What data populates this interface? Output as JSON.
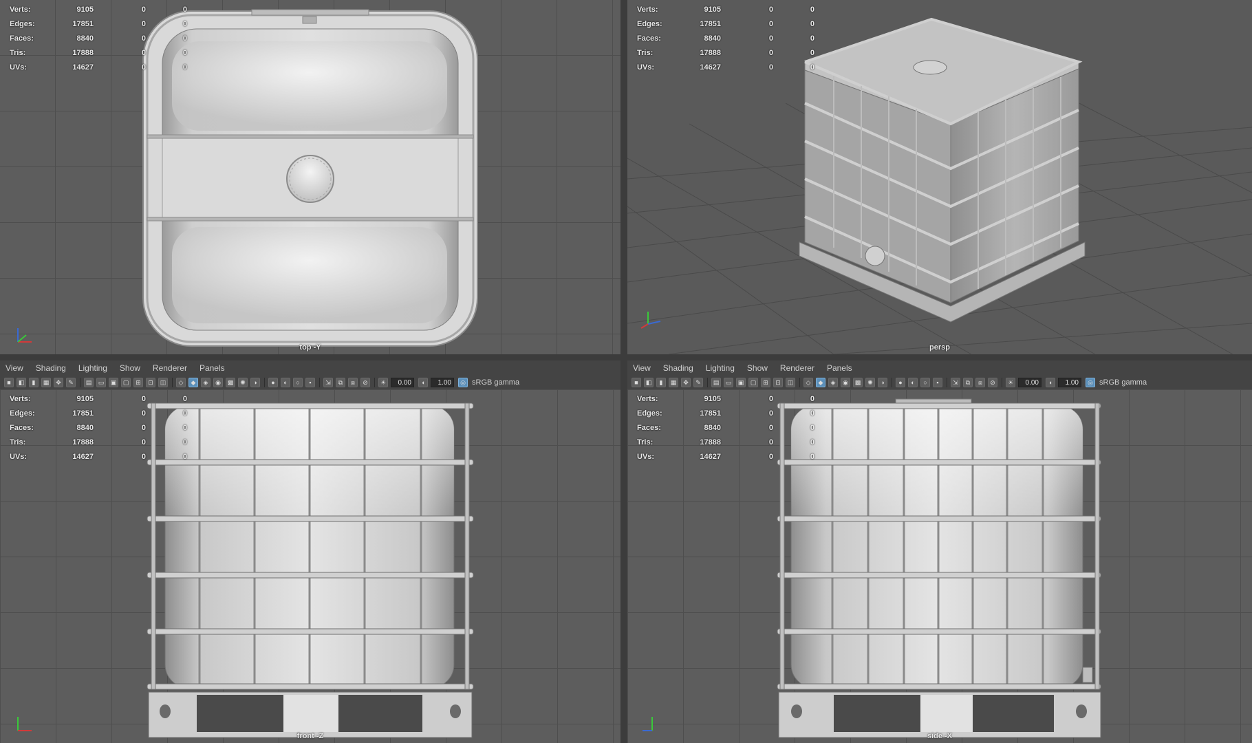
{
  "hud_stats": [
    {
      "label": "Verts:",
      "value": "9105",
      "sel": "0",
      "comp": "0"
    },
    {
      "label": "Edges:",
      "value": "17851",
      "sel": "0",
      "comp": "0"
    },
    {
      "label": "Faces:",
      "value": "8840",
      "sel": "0",
      "comp": "0"
    },
    {
      "label": "Tris:",
      "value": "17888",
      "sel": "0",
      "comp": "0"
    },
    {
      "label": "UVs:",
      "value": "14627",
      "sel": "0",
      "comp": "0"
    }
  ],
  "viewports": {
    "top": {
      "camera": "top -Y"
    },
    "persp": {
      "camera": "persp"
    },
    "front": {
      "camera": "front -Z"
    },
    "side": {
      "camera": "side -X"
    }
  },
  "panel_menu": [
    "View",
    "Shading",
    "Lighting",
    "Show",
    "Renderer",
    "Panels"
  ],
  "toolbar": {
    "exposure": "0.00",
    "gamma": "1.00",
    "color_space": "sRGB gamma"
  },
  "icons": {
    "camera": "camera-icon",
    "wireframe": "wireframe-icon",
    "smooth_shade": "smooth-shade-icon",
    "textured": "textured-icon",
    "lights": "lights-icon",
    "shadows": "shadows-icon",
    "isolate": "isolate-icon",
    "xray": "xray-icon",
    "exposure": "exposure-icon",
    "gamma": "gamma-icon",
    "color_mgmt": "color-management-icon"
  },
  "colors": {
    "viewport_bg": "#5d5d5d",
    "ui_bg": "#444444",
    "active_icon": "#5b8fb9",
    "axis_x": "#d23a3a",
    "axis_y": "#3ac83a",
    "axis_z": "#3a6ad2"
  }
}
